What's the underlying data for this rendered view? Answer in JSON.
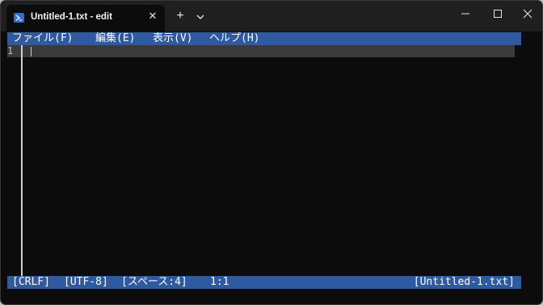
{
  "tab": {
    "title": "Untitled-1.txt - edit",
    "close_glyph": "✕",
    "icon": "powershell-icon"
  },
  "titlebar": {
    "new_tab_glyph": "+",
    "accent": "#2f6ed6"
  },
  "menu": {
    "bg_color": "#2d5aa0",
    "items": [
      {
        "label": "ファイル(F)"
      },
      {
        "label": "編集(E)"
      },
      {
        "label": "表示(V)"
      },
      {
        "label": "ヘルプ(H)"
      }
    ]
  },
  "editor": {
    "line_number": "1"
  },
  "status": {
    "line_ending": "[CRLF]",
    "encoding": "[UTF-8]",
    "indent": "[スペース:4]",
    "position": "1:1",
    "filename": "[Untitled-1.txt]"
  }
}
